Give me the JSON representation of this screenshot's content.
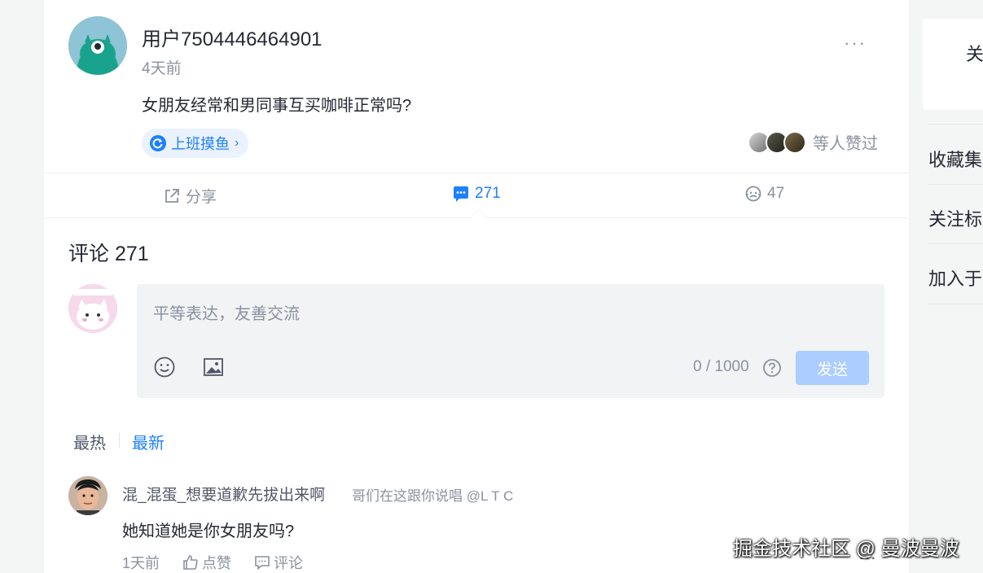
{
  "post": {
    "username": "用户7504446464901",
    "time": "4天前",
    "more": "···",
    "text": "女朋友经常和男同事互买咖啡正常吗?",
    "topic": "上班摸鱼",
    "topic_chevron": "›",
    "likers_text": "等人赞过"
  },
  "actions": {
    "share": "分享",
    "comments": "271",
    "reactions": "47"
  },
  "comments": {
    "title": "评论 271",
    "placeholder": "平等表达，友善交流",
    "counter": "0 / 1000",
    "send": "发送",
    "sort_hot": "最热",
    "sort_new": "最新"
  },
  "comment1": {
    "user": "混_混蛋_想要道歉先拔出来啊",
    "user_title": "哥们在这跟你说唱 @L T C",
    "text": "她知道她是你女朋友吗?",
    "time": "1天前",
    "like": "点赞",
    "reply": "评论",
    "more": "···"
  },
  "sidebar": {
    "card_text": "关",
    "items": [
      "收藏集",
      "关注标",
      "加入于"
    ]
  },
  "watermark": "掘金技术社区 @ 曼波曼波",
  "colors": {
    "accent": "#1e80ff",
    "muted": "#8a919f",
    "send_disabled": "#abcdff"
  },
  "icons": {
    "share": "share-icon",
    "comment": "comment-bubble-icon",
    "reaction": "face-icon",
    "topic": "refresh-circle-icon",
    "emoji": "emoji-icon",
    "image": "image-icon",
    "help": "question-icon",
    "like": "thumb-up-icon",
    "reply": "reply-bubble-icon"
  }
}
